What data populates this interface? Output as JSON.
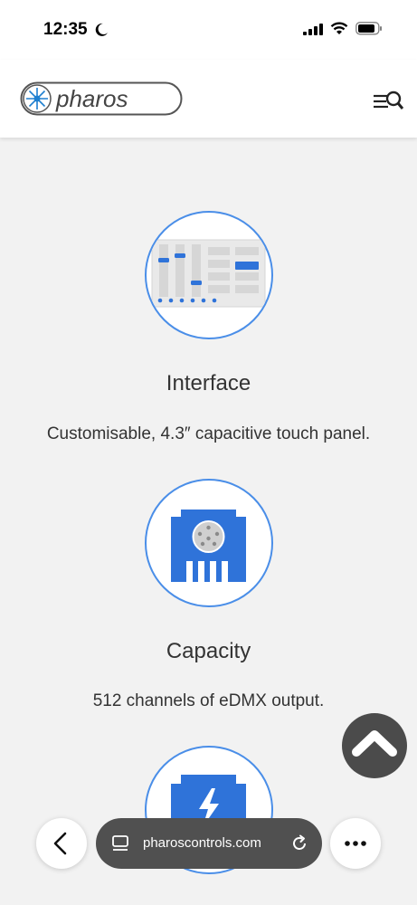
{
  "status": {
    "time": "12:35",
    "icons": [
      "moon-icon",
      "signal-icon",
      "wifi-icon",
      "battery-icon"
    ]
  },
  "header": {
    "logo_text": "pharos",
    "menu_icon": "menu-search-icon"
  },
  "features": [
    {
      "title": "Interface",
      "description": "Customisable, 4.3″ capacitive touch panel.",
      "icon": "touch-panel-icon"
    },
    {
      "title": "Capacity",
      "description": "512 channels of eDMX output.",
      "icon": "dmx-connector-icon"
    },
    {
      "title": "",
      "description": "",
      "icon": "power-connector-icon"
    }
  ],
  "scroll_top": {
    "icon": "chevron-up-icon"
  },
  "browser": {
    "url": "pharoscontrols.com",
    "back_icon": "chevron-left-icon",
    "tabs_icon": "tabs-icon",
    "reload_icon": "reload-icon",
    "more_icon": "more-icon"
  },
  "colors": {
    "accent": "#4a8ee8",
    "icon_blue": "#2f73d9",
    "background": "#f2f2f2"
  }
}
